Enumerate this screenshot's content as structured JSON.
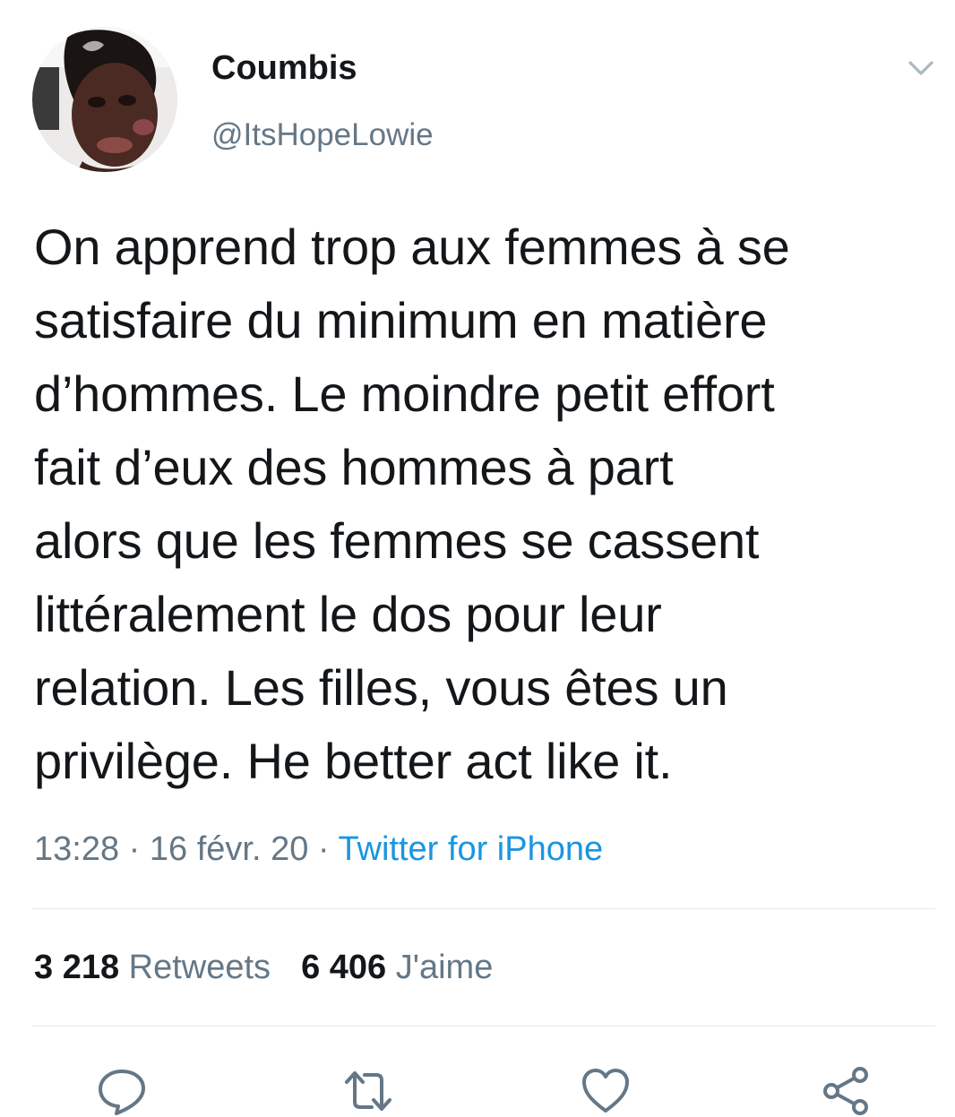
{
  "user": {
    "display_name": "Coumbis",
    "handle": "@ItsHopeLowie",
    "avatar_icon": "profile-photo"
  },
  "tweet": {
    "lines": [
      "On apprend trop aux femmes à se",
      "satisfaire du minimum en matière",
      "d’hommes. Le moindre petit effort",
      "fait d’eux des hommes à part",
      "alors que les femmes se cassent",
      "littéralement le dos pour leur",
      "relation. Les filles, vous êtes un",
      "privilège. He better act like it."
    ]
  },
  "meta": {
    "time": "13:28",
    "separator": " · ",
    "date": "16 févr. 20",
    "source": "Twitter for iPhone"
  },
  "stats": {
    "retweets_count": "3 218",
    "retweets_label": "Retweets",
    "likes_count": "6 406",
    "likes_label": "J'aime"
  },
  "actions": {
    "reply_icon": "reply-icon",
    "retweet_icon": "retweet-icon",
    "like_icon": "heart-icon",
    "share_icon": "share-icon"
  },
  "colors": {
    "text": "#14171a",
    "secondary": "#657786",
    "link": "#1b95e0",
    "divider": "#e1e8ed",
    "icon": "#657786"
  }
}
